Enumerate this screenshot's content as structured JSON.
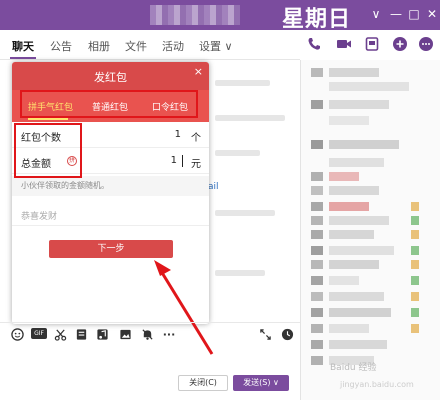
{
  "window": {
    "title_overlay": "星期日",
    "controls": [
      "∨",
      "—",
      "□",
      "✕"
    ]
  },
  "tabs": [
    "聊天",
    "公告",
    "相册",
    "文件",
    "活动",
    "设置 ∨"
  ],
  "top_icons": [
    "phone-icon",
    "video-icon",
    "screen-icon",
    "add-icon",
    "more-icon"
  ],
  "dialog": {
    "title": "发红包",
    "close": "×",
    "types": [
      "拼手气红包",
      "普通红包",
      "口令红包"
    ],
    "count_label": "红包个数",
    "count_value": "1",
    "count_unit": "个",
    "total_label": "总金额",
    "pin_badge": "拼",
    "total_value": "1",
    "total_unit": "元",
    "hint": "小伙伴领取的金额随机。",
    "message_placeholder": "恭喜发财",
    "next_label": "下一步"
  },
  "link_hint": "ail",
  "toolbar": {
    "icons": [
      "emoji-icon",
      "gif-icon",
      "scissors-icon",
      "folder-icon",
      "music-icon",
      "image-icon",
      "bell-icon",
      "ellipsis-icon",
      "expand-icon",
      "clock-icon"
    ],
    "gif_label": "GIF",
    "ellipsis": "···"
  },
  "buttons": {
    "close_label": "关闭(C)",
    "send_label": "发送(S) ∨"
  },
  "watermark": {
    "line1": "Baidu 经验",
    "line2": "jingyan.baidu.com"
  },
  "colors": {
    "titlebar": "#7b4c9e",
    "dialog_header": "#d84a4a",
    "dialog_tabs": "#e9534f",
    "highlight_box": "#e0161a",
    "active_tab_text": "#ffe36e"
  }
}
